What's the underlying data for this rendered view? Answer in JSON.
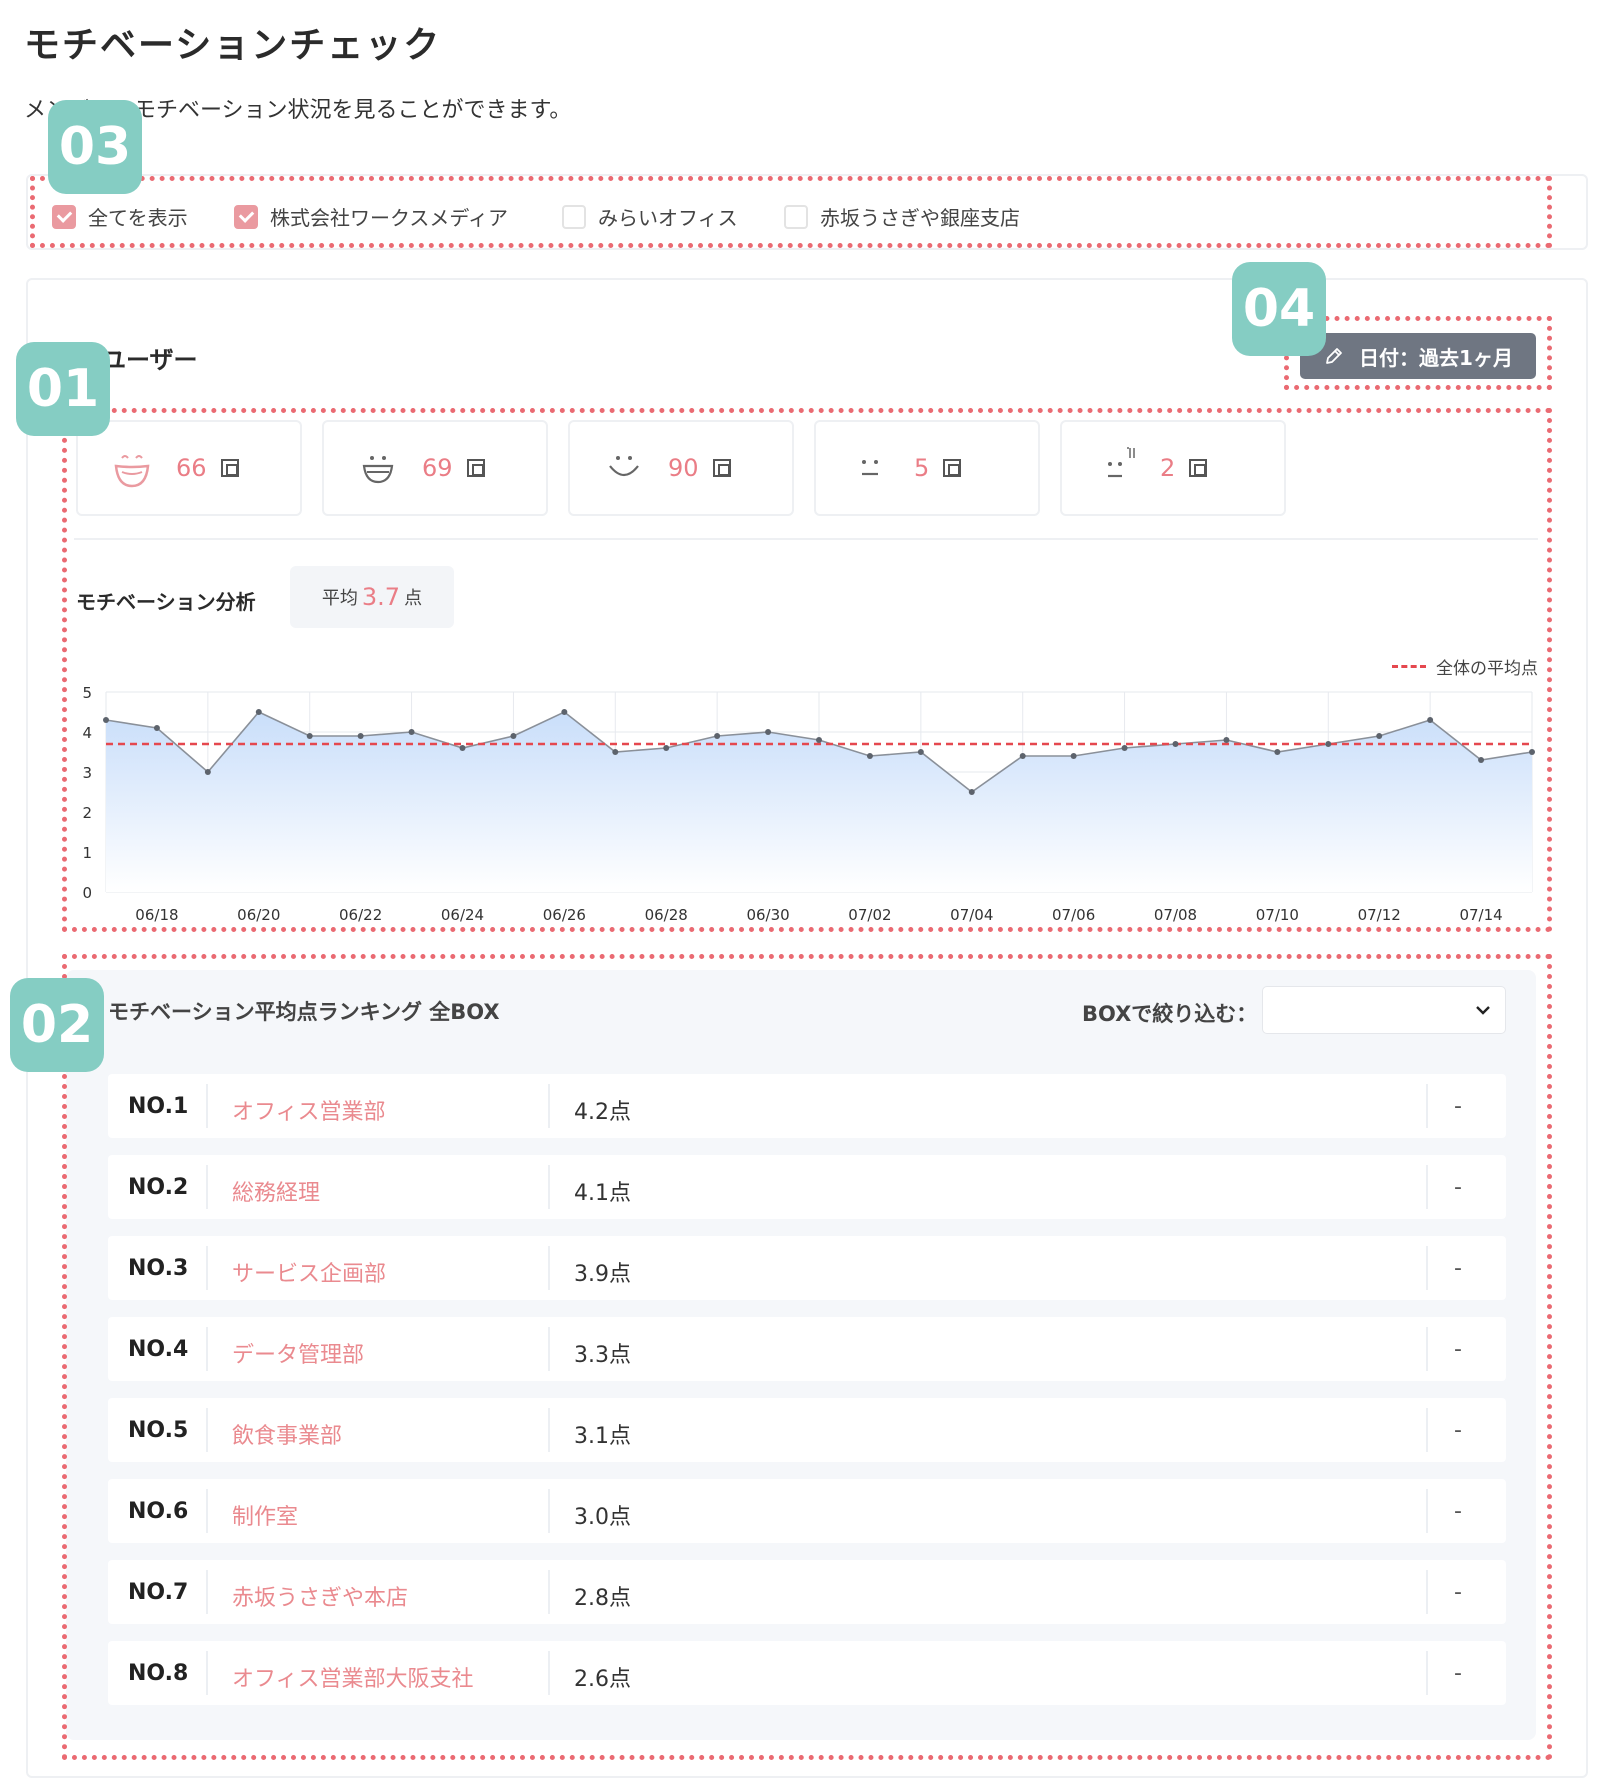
{
  "page": {
    "title": "モチベーションチェック",
    "description": "メンバーのモチベーション状況を見ることができます。"
  },
  "filters": [
    {
      "label": "全てを表示",
      "checked": true
    },
    {
      "label": "株式会社ワークスメディア",
      "checked": true
    },
    {
      "label": "みらいオフィス",
      "checked": false
    },
    {
      "label": "赤坂うさぎや銀座支店",
      "checked": false
    }
  ],
  "section": {
    "title": "ユーザー",
    "date_button": "日付：過去1ヶ月"
  },
  "emotions": [
    {
      "icon": "very-happy-face-icon",
      "count": "66",
      "unit_icon": "count-unit-icon"
    },
    {
      "icon": "happy-face-icon",
      "count": "69",
      "unit_icon": "count-unit-icon"
    },
    {
      "icon": "smile-face-icon",
      "count": "90",
      "unit_icon": "count-unit-icon"
    },
    {
      "icon": "neutral-face-icon",
      "count": "5",
      "unit_icon": "count-unit-icon"
    },
    {
      "icon": "sad-face-icon",
      "count": "2",
      "unit_icon": "count-unit-icon"
    }
  ],
  "analysis": {
    "title": "モチベーション分析",
    "avg_prefix": "平均",
    "avg_value": "3.7",
    "avg_suffix": "点",
    "legend_label": "全体の平均点"
  },
  "chart_data": {
    "type": "area",
    "x": [
      "06/17",
      "06/18",
      "06/19",
      "06/20",
      "06/21",
      "06/22",
      "06/23",
      "06/24",
      "06/25",
      "06/26",
      "06/27",
      "06/28",
      "06/29",
      "06/30",
      "07/01",
      "07/02",
      "07/03",
      "07/04",
      "07/05",
      "07/06",
      "07/07",
      "07/08",
      "07/09",
      "07/10",
      "07/11",
      "07/12",
      "07/13",
      "07/14",
      "07/15"
    ],
    "y": [
      4.3,
      4.1,
      3.0,
      4.5,
      3.9,
      3.9,
      4.0,
      3.6,
      3.9,
      4.5,
      3.5,
      3.6,
      3.9,
      4.0,
      3.8,
      3.4,
      3.5,
      2.5,
      3.4,
      3.4,
      3.6,
      3.7,
      3.8,
      3.5,
      3.7,
      3.9,
      4.3,
      3.3,
      3.5
    ],
    "x_tick_labels": [
      "06/18",
      "06/20",
      "06/22",
      "06/24",
      "06/26",
      "06/28",
      "06/30",
      "07/02",
      "07/04",
      "07/06",
      "07/08",
      "07/10",
      "07/12",
      "07/14"
    ],
    "y_ticks": [
      0,
      1,
      2,
      3,
      4,
      5
    ],
    "ylim": [
      0,
      5
    ],
    "average_line": 3.7,
    "grid": true,
    "legend_position": "top-right",
    "colors": {
      "line": "#8a9099",
      "fill_top": "#c9defa",
      "fill_bottom": "#ffffff",
      "average": "#e5484f"
    }
  },
  "ranking": {
    "title": "モチベーション平均点ランキング 全BOX",
    "filter_label": "BOXで絞り込む：",
    "select_value": "",
    "rows": [
      {
        "no": "NO.1",
        "name": "オフィス営業部",
        "score": "4.2点",
        "trend": "-"
      },
      {
        "no": "NO.2",
        "name": "総務経理",
        "score": "4.1点",
        "trend": "-"
      },
      {
        "no": "NO.3",
        "name": "サービス企画部",
        "score": "3.9点",
        "trend": "-"
      },
      {
        "no": "NO.4",
        "name": "データ管理部",
        "score": "3.3点",
        "trend": "-"
      },
      {
        "no": "NO.5",
        "name": "飲食事業部",
        "score": "3.1点",
        "trend": "-"
      },
      {
        "no": "NO.6",
        "name": "制作室",
        "score": "3.0点",
        "trend": "-"
      },
      {
        "no": "NO.7",
        "name": "赤坂うさぎや本店",
        "score": "2.8点",
        "trend": "-"
      },
      {
        "no": "NO.8",
        "name": "オフィス営業部大阪支社",
        "score": "2.6点",
        "trend": "-"
      }
    ]
  },
  "badges": [
    "01",
    "02",
    "03",
    "04"
  ],
  "colors": {
    "accent": "#ea7d86",
    "badge": "#85cdc3",
    "highlight_border": "#ea6a72"
  }
}
